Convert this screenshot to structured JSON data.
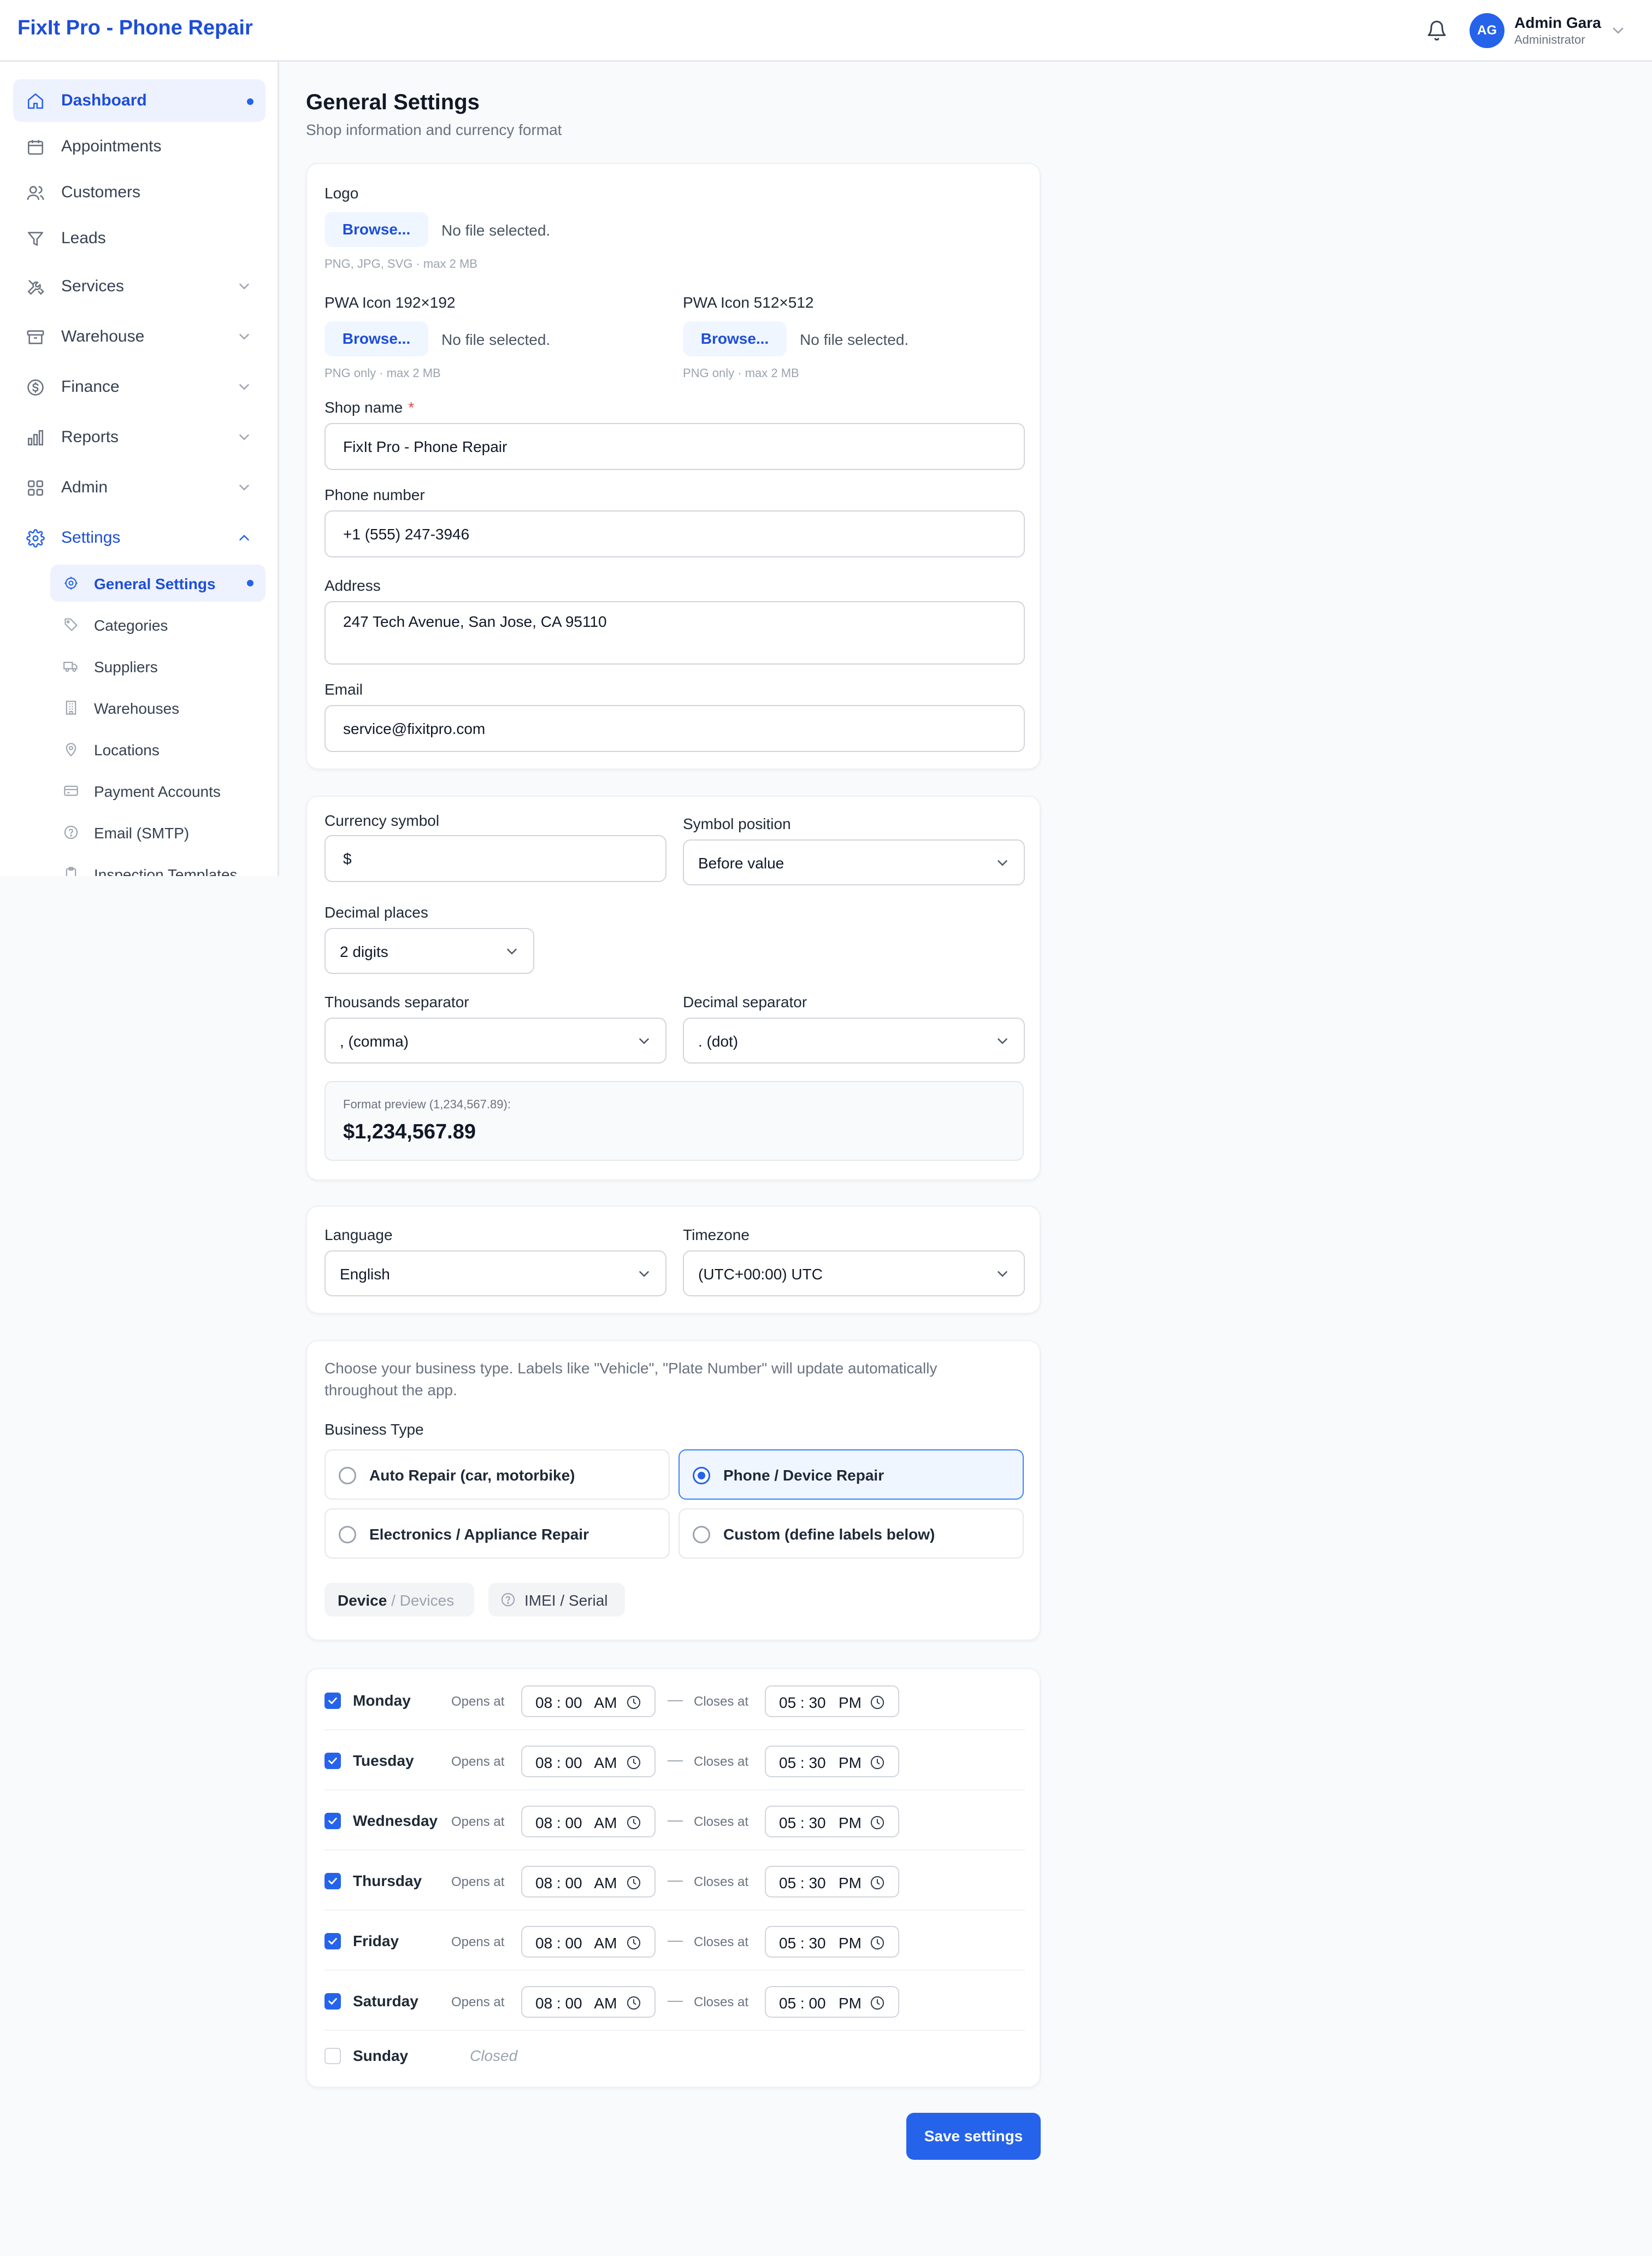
{
  "header": {
    "app_title": "FixIt Pro - Phone Repair",
    "user": {
      "initials": "AG",
      "name": "Admin Gara",
      "role": "Administrator"
    }
  },
  "sidebar": {
    "items": [
      {
        "label": "Dashboard",
        "icon": "home-icon",
        "active": true
      },
      {
        "label": "Appointments",
        "icon": "calendar-icon"
      },
      {
        "label": "Customers",
        "icon": "users-icon"
      },
      {
        "label": "Leads",
        "icon": "funnel-icon"
      },
      {
        "label": "Services",
        "icon": "tools-icon",
        "expandable": true
      },
      {
        "label": "Warehouse",
        "icon": "archive-icon",
        "expandable": true
      },
      {
        "label": "Finance",
        "icon": "dollar-icon",
        "expandable": true
      },
      {
        "label": "Reports",
        "icon": "bar-chart-icon",
        "expandable": true
      },
      {
        "label": "Admin",
        "icon": "grid-icon",
        "expandable": true
      },
      {
        "label": "Settings",
        "icon": "gear-icon",
        "expanded": true
      }
    ],
    "settings_sub": [
      {
        "label": "General Settings",
        "icon": "gear-icon",
        "active": true
      },
      {
        "label": "Categories",
        "icon": "tag-icon"
      },
      {
        "label": "Suppliers",
        "icon": "truck-icon"
      },
      {
        "label": "Warehouses",
        "icon": "building-icon"
      },
      {
        "label": "Locations",
        "icon": "pin-icon"
      },
      {
        "label": "Payment Accounts",
        "icon": "card-icon"
      },
      {
        "label": "Email (SMTP)",
        "icon": "help-icon"
      },
      {
        "label": "Inspection Templates",
        "icon": "clipboard-icon"
      }
    ]
  },
  "page": {
    "title": "General Settings",
    "subtitle": "Shop information and currency format"
  },
  "shop": {
    "logo_label": "Logo",
    "browse_label": "Browse...",
    "no_file": "No file selected.",
    "logo_hint": "PNG, JPG, SVG · max 2 MB",
    "pwa192_label": "PWA Icon 192×192",
    "pwa512_label": "PWA Icon 512×512",
    "pwa_hint": "PNG only · max 2 MB",
    "shop_name_label": "Shop name",
    "required_mark": "*",
    "shop_name_value": "FixIt Pro - Phone Repair",
    "phone_label": "Phone number",
    "phone_value": "+1 (555) 247-3946",
    "address_label": "Address",
    "address_value": "247 Tech Avenue, San Jose, CA 95110",
    "email_label": "Email",
    "email_value": "service@fixitpro.com"
  },
  "currency": {
    "symbol_label": "Currency symbol",
    "symbol_value": "$",
    "position_label": "Symbol position",
    "position_value": "Before value",
    "decimals_label": "Decimal places",
    "decimals_value": "2 digits",
    "thousands_label": "Thousands separator",
    "thousands_value": ", (comma)",
    "decimal_sep_label": "Decimal separator",
    "decimal_sep_value": ". (dot)",
    "preview_caption": "Format preview (1,234,567.89):",
    "preview_value": "$1,234,567.89"
  },
  "locale": {
    "language_label": "Language",
    "language_value": "English",
    "timezone_label": "Timezone",
    "timezone_value": "(UTC+00:00) UTC"
  },
  "business": {
    "description": "Choose your business type. Labels like \"Vehicle\", \"Plate Number\" will update automatically throughout the app.",
    "type_label": "Business Type",
    "options": [
      {
        "label": "Auto Repair (car, motorbike)",
        "selected": false
      },
      {
        "label": "Phone / Device Repair",
        "selected": true
      },
      {
        "label": "Electronics / Appliance Repair",
        "selected": false
      },
      {
        "label": "Custom (define labels below)",
        "selected": false
      }
    ],
    "chip_singular": "Device",
    "chip_plural": "/ Devices",
    "chip_identifier": "IMEI / Serial"
  },
  "hours": {
    "opens_label": "Opens at",
    "closes_label": "Closes at",
    "dash": "—",
    "closed_label": "Closed",
    "days": [
      {
        "day": "Monday",
        "enabled": true,
        "open": "08 : 00   AM",
        "close": "05 : 30   PM"
      },
      {
        "day": "Tuesday",
        "enabled": true,
        "open": "08 : 00   AM",
        "close": "05 : 30   PM"
      },
      {
        "day": "Wednesday",
        "enabled": true,
        "open": "08 : 00   AM",
        "close": "05 : 30   PM"
      },
      {
        "day": "Thursday",
        "enabled": true,
        "open": "08 : 00   AM",
        "close": "05 : 30   PM"
      },
      {
        "day": "Friday",
        "enabled": true,
        "open": "08 : 00   AM",
        "close": "05 : 30   PM"
      },
      {
        "day": "Saturday",
        "enabled": true,
        "open": "08 : 00   AM",
        "close": "05 : 00   PM"
      },
      {
        "day": "Sunday",
        "enabled": false
      }
    ]
  },
  "actions": {
    "save_label": "Save settings"
  },
  "colors": {
    "accent": "#2563eb",
    "brand_text": "#1d4ed8",
    "required": "#ef4444"
  }
}
